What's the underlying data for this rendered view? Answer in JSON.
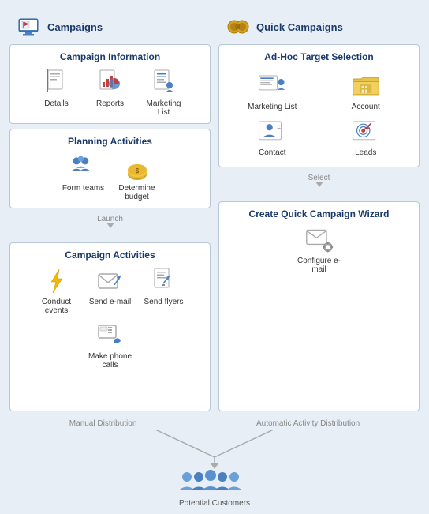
{
  "left": {
    "header": "Campaigns",
    "campaign_info": {
      "title": "Campaign Information",
      "items": [
        {
          "label": "Details",
          "icon": "document-icon"
        },
        {
          "label": "Reports",
          "icon": "chart-icon"
        },
        {
          "label": "Marketing List",
          "icon": "list-icon"
        }
      ]
    },
    "planning": {
      "title": "Planning Activities",
      "items": [
        {
          "label": "Form teams",
          "icon": "teams-icon"
        },
        {
          "label": "Determine budget",
          "icon": "budget-icon"
        }
      ]
    },
    "launch_label": "Launch",
    "campaign_activities": {
      "title": "Campaign Activities",
      "items": [
        {
          "label": "Conduct events",
          "icon": "lightning-icon"
        },
        {
          "label": "Send e-mail",
          "icon": "email-icon"
        },
        {
          "label": "Send flyers",
          "icon": "flyer-icon"
        },
        {
          "label": "Make phone calls",
          "icon": "phone-icon"
        }
      ]
    }
  },
  "right": {
    "header": "Quick Campaigns",
    "adhoc": {
      "title": "Ad-Hoc Target Selection",
      "items": [
        {
          "label": "Marketing List",
          "icon": "mktlist-icon"
        },
        {
          "label": "Account",
          "icon": "account-icon"
        },
        {
          "label": "Contact",
          "icon": "contact-icon"
        },
        {
          "label": "Leads",
          "icon": "leads-icon"
        }
      ]
    },
    "select_label": "Select",
    "wizard": {
      "title": "Create Quick Campaign Wizard",
      "items": [
        {
          "label": "Configure e-mail",
          "icon": "config-email-icon"
        }
      ]
    }
  },
  "bottom": {
    "manual_label": "Manual Distribution",
    "auto_label": "Automatic Activity Distribution",
    "customers_label": "Potential Customers"
  }
}
